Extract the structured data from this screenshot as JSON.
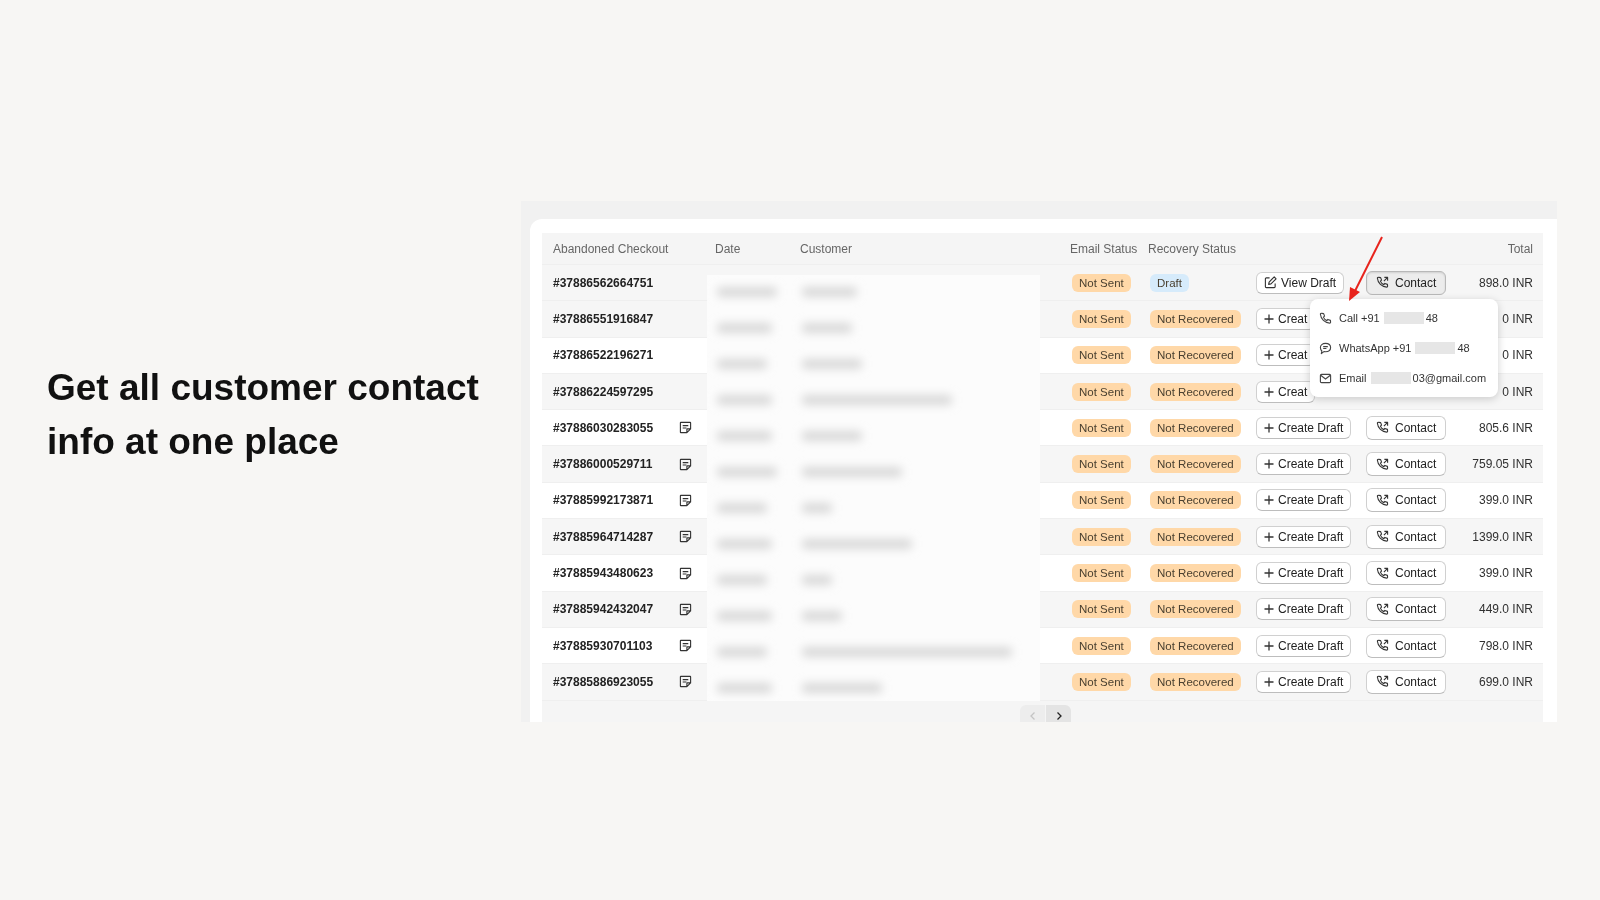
{
  "headline": "Get all customer contact info at one place",
  "table": {
    "columns": [
      "Abandoned Checkout",
      "Date",
      "Customer",
      "Email Status",
      "Recovery Status",
      "",
      "",
      "Total"
    ],
    "rows": [
      {
        "checkout": "#37886562664751",
        "has_note": false,
        "hovered": true,
        "email_status": {
          "label": "Not Sent",
          "color": "#ffd8a8"
        },
        "recovery_status": {
          "label": "Draft",
          "color": "#d6ebfb"
        },
        "action": {
          "kind": "view",
          "label": "View Draft"
        },
        "contact": {
          "label": "Contact",
          "active": true
        },
        "total": "898.0 INR"
      },
      {
        "checkout": "#37886551916847",
        "has_note": false,
        "hovered": false,
        "email_status": {
          "label": "Not Sent",
          "color": "#ffd8a8"
        },
        "recovery_status": {
          "label": "Not Recovered",
          "color": "#ffd8a8"
        },
        "action": {
          "kind": "create",
          "label": "Creat"
        },
        "total": "0 INR"
      },
      {
        "checkout": "#37886522196271",
        "has_note": false,
        "hovered": false,
        "email_status": {
          "label": "Not Sent",
          "color": "#ffd8a8"
        },
        "recovery_status": {
          "label": "Not Recovered",
          "color": "#ffd8a8"
        },
        "action": {
          "kind": "create",
          "label": "Creat"
        },
        "total": "0 INR"
      },
      {
        "checkout": "#37886224597295",
        "has_note": false,
        "hovered": false,
        "email_status": {
          "label": "Not Sent",
          "color": "#ffd8a8"
        },
        "recovery_status": {
          "label": "Not Recovered",
          "color": "#ffd8a8"
        },
        "action": {
          "kind": "create",
          "label": "Creat"
        },
        "total": "0 INR"
      },
      {
        "checkout": "#37886030283055",
        "has_note": true,
        "hovered": false,
        "email_status": {
          "label": "Not Sent",
          "color": "#ffd8a8"
        },
        "recovery_status": {
          "label": "Not Recovered",
          "color": "#ffd8a8"
        },
        "action": {
          "kind": "create",
          "label": "Create Draft"
        },
        "contact": {
          "label": "Contact",
          "active": false
        },
        "total": "805.6 INR"
      },
      {
        "checkout": "#37886000529711",
        "has_note": true,
        "hovered": false,
        "email_status": {
          "label": "Not Sent",
          "color": "#ffd8a8"
        },
        "recovery_status": {
          "label": "Not Recovered",
          "color": "#ffd8a8"
        },
        "action": {
          "kind": "create",
          "label": "Create Draft"
        },
        "contact": {
          "label": "Contact",
          "active": false
        },
        "total": "759.05 INR"
      },
      {
        "checkout": "#37885992173871",
        "has_note": true,
        "hovered": false,
        "email_status": {
          "label": "Not Sent",
          "color": "#ffd8a8"
        },
        "recovery_status": {
          "label": "Not Recovered",
          "color": "#ffd8a8"
        },
        "action": {
          "kind": "create",
          "label": "Create Draft"
        },
        "contact": {
          "label": "Contact",
          "active": false
        },
        "total": "399.0 INR"
      },
      {
        "checkout": "#37885964714287",
        "has_note": true,
        "hovered": false,
        "email_status": {
          "label": "Not Sent",
          "color": "#ffd8a8"
        },
        "recovery_status": {
          "label": "Not Recovered",
          "color": "#ffd8a8"
        },
        "action": {
          "kind": "create",
          "label": "Create Draft"
        },
        "contact": {
          "label": "Contact",
          "active": false
        },
        "total": "1399.0 INR"
      },
      {
        "checkout": "#37885943480623",
        "has_note": true,
        "hovered": false,
        "email_status": {
          "label": "Not Sent",
          "color": "#ffd8a8"
        },
        "recovery_status": {
          "label": "Not Recovered",
          "color": "#ffd8a8"
        },
        "action": {
          "kind": "create",
          "label": "Create Draft"
        },
        "contact": {
          "label": "Contact",
          "active": false
        },
        "total": "399.0 INR"
      },
      {
        "checkout": "#37885942432047",
        "has_note": true,
        "hovered": false,
        "email_status": {
          "label": "Not Sent",
          "color": "#ffd8a8"
        },
        "recovery_status": {
          "label": "Not Recovered",
          "color": "#ffd8a8"
        },
        "action": {
          "kind": "create",
          "label": "Create Draft"
        },
        "contact": {
          "label": "Contact",
          "active": false
        },
        "total": "449.0 INR"
      },
      {
        "checkout": "#37885930701103",
        "has_note": true,
        "hovered": false,
        "email_status": {
          "label": "Not Sent",
          "color": "#ffd8a8"
        },
        "recovery_status": {
          "label": "Not Recovered",
          "color": "#ffd8a8"
        },
        "action": {
          "kind": "create",
          "label": "Create Draft"
        },
        "contact": {
          "label": "Contact",
          "active": false
        },
        "total": "798.0 INR"
      },
      {
        "checkout": "#37885886923055",
        "has_note": true,
        "hovered": false,
        "email_status": {
          "label": "Not Sent",
          "color": "#ffd8a8"
        },
        "recovery_status": {
          "label": "Not Recovered",
          "color": "#ffd8a8"
        },
        "action": {
          "kind": "create",
          "label": "Create Draft"
        },
        "contact": {
          "label": "Contact",
          "active": false
        },
        "total": "699.0 INR"
      }
    ]
  },
  "contact_menu": [
    {
      "kind": "call",
      "label": "Call +91",
      "tail": "48"
    },
    {
      "kind": "whatsapp",
      "label": "WhatsApp +91",
      "tail": "48"
    },
    {
      "kind": "email",
      "label": "Email",
      "tail": "03@gmail.com"
    }
  ],
  "pagination": {
    "previous_disabled": true,
    "next_disabled": false
  }
}
